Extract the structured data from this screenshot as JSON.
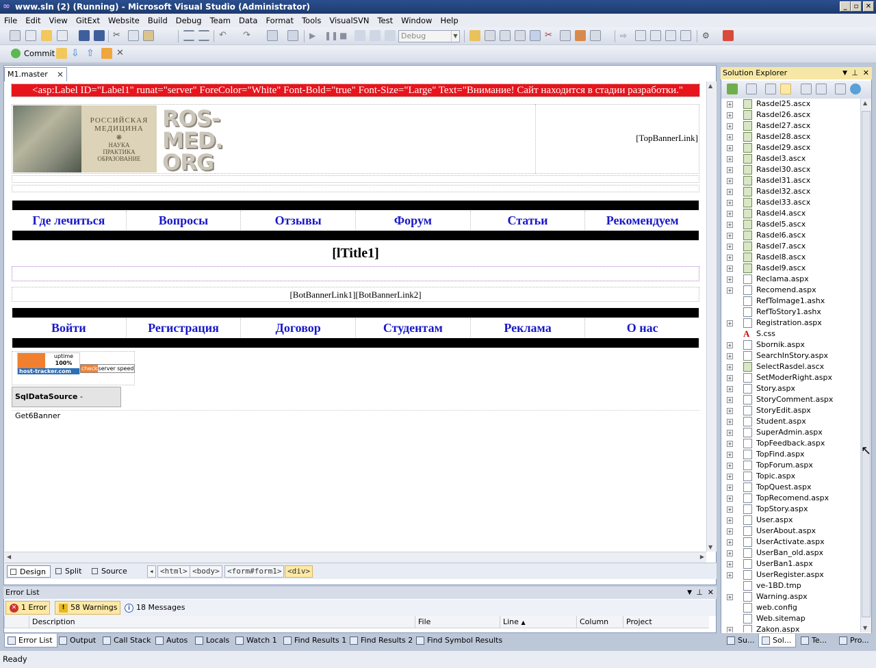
{
  "window": {
    "title": "www.sln (2) (Running) - Microsoft Visual Studio (Administrator)"
  },
  "menu": [
    "File",
    "Edit",
    "View",
    "GitExt",
    "Website",
    "Build",
    "Debug",
    "Team",
    "Data",
    "Format",
    "Tools",
    "VisualSVN",
    "Test",
    "Window",
    "Help"
  ],
  "toolbar": {
    "config": "Debug",
    "commit_label": "Commit"
  },
  "editor": {
    "tab_label": "M1.master",
    "label_markup": "<asp:Label ID=\"Label1\" runat=\"server\" ForeColor=\"White\" Font-Bold=\"true\" Font-Size=\"Large\" Text=\"Внимание! Сайт находится в стадии разработки.\"",
    "banner_text": {
      "ru1": "РОССИЙСКАЯ",
      "ru2": "МЕДИЦИНА",
      "ru3": "НАУКА",
      "ru4": "ПРАКТИКА",
      "ru5": "ОБРАЗОВАНИЕ"
    },
    "logo_lines": [
      "ROS-",
      "MED.",
      "ORG"
    ],
    "top_banner_link": "[TopBannerLink]",
    "nav_top": [
      "Где лечиться",
      "Вопросы",
      "Отзывы",
      "Форум",
      "Статьи",
      "Рекомендуем"
    ],
    "title_placeholder": "[lTitle1]",
    "bot_banner": "[BotBannerLink1][BotBannerLink2]",
    "nav_bottom": [
      "Войти",
      "Регистрация",
      "Договор",
      "Студентам",
      "Реклама",
      "О нас"
    ],
    "tracker": {
      "uptime": "uptime",
      "percent": "100%",
      "brand": "host-tracker.com",
      "check": "check",
      "speed": "server speed"
    },
    "sqldatasource": {
      "type": "SqlDataSource",
      "name": " - Get6Banner"
    }
  },
  "viewbar": {
    "design": "Design",
    "split": "Split",
    "source": "Source",
    "crumbs": [
      "<html>",
      "<body>",
      "<form#form1>",
      "<div>"
    ]
  },
  "solution_explorer": {
    "title": "Solution Explorer",
    "items": [
      {
        "name": "Rasdel25.ascx",
        "type": "ascx",
        "expand": true
      },
      {
        "name": "Rasdel26.ascx",
        "type": "ascx",
        "expand": true
      },
      {
        "name": "Rasdel27.ascx",
        "type": "ascx",
        "expand": true
      },
      {
        "name": "Rasdel28.ascx",
        "type": "ascx",
        "expand": true
      },
      {
        "name": "Rasdel29.ascx",
        "type": "ascx",
        "expand": true
      },
      {
        "name": "Rasdel3.ascx",
        "type": "ascx",
        "expand": true
      },
      {
        "name": "Rasdel30.ascx",
        "type": "ascx",
        "expand": true
      },
      {
        "name": "Rasdel31.ascx",
        "type": "ascx",
        "expand": true
      },
      {
        "name": "Rasdel32.ascx",
        "type": "ascx",
        "expand": true
      },
      {
        "name": "Rasdel33.ascx",
        "type": "ascx",
        "expand": true
      },
      {
        "name": "Rasdel4.ascx",
        "type": "ascx",
        "expand": true
      },
      {
        "name": "Rasdel5.ascx",
        "type": "ascx",
        "expand": true
      },
      {
        "name": "Rasdel6.ascx",
        "type": "ascx",
        "expand": true
      },
      {
        "name": "Rasdel7.ascx",
        "type": "ascx",
        "expand": true
      },
      {
        "name": "Rasdel8.ascx",
        "type": "ascx",
        "expand": true
      },
      {
        "name": "Rasdel9.ascx",
        "type": "ascx",
        "expand": true
      },
      {
        "name": "Reclama.aspx",
        "type": "aspx",
        "expand": true
      },
      {
        "name": "Recomend.aspx",
        "type": "aspx",
        "expand": true
      },
      {
        "name": "RefToImage1.ashx",
        "type": "ashx",
        "expand": false
      },
      {
        "name": "RefToStory1.ashx",
        "type": "ashx",
        "expand": false
      },
      {
        "name": "Registration.aspx",
        "type": "aspx",
        "expand": true
      },
      {
        "name": "S.css",
        "type": "css",
        "expand": false
      },
      {
        "name": "Sbornik.aspx",
        "type": "aspx",
        "expand": true
      },
      {
        "name": "SearchInStory.aspx",
        "type": "aspx",
        "expand": true
      },
      {
        "name": "SelectRasdel.ascx",
        "type": "ascx",
        "expand": true
      },
      {
        "name": "SetModerRight.aspx",
        "type": "aspx",
        "expand": true
      },
      {
        "name": "Story.aspx",
        "type": "aspx",
        "expand": true
      },
      {
        "name": "StoryComment.aspx",
        "type": "aspx",
        "expand": true
      },
      {
        "name": "StoryEdit.aspx",
        "type": "aspx",
        "expand": true
      },
      {
        "name": "Student.aspx",
        "type": "aspx",
        "expand": true
      },
      {
        "name": "SuperAdmin.aspx",
        "type": "aspx",
        "expand": true
      },
      {
        "name": "TopFeedback.aspx",
        "type": "aspx",
        "expand": true
      },
      {
        "name": "TopFind.aspx",
        "type": "aspx",
        "expand": true
      },
      {
        "name": "TopForum.aspx",
        "type": "aspx",
        "expand": true
      },
      {
        "name": "Topic.aspx",
        "type": "aspx",
        "expand": true
      },
      {
        "name": "TopQuest.aspx",
        "type": "aspx",
        "expand": true
      },
      {
        "name": "TopRecomend.aspx",
        "type": "aspx",
        "expand": true
      },
      {
        "name": "TopStory.aspx",
        "type": "aspx",
        "expand": true
      },
      {
        "name": "User.aspx",
        "type": "aspx",
        "expand": true
      },
      {
        "name": "UserAbout.aspx",
        "type": "aspx",
        "expand": true
      },
      {
        "name": "UserActivate.aspx",
        "type": "aspx",
        "expand": true
      },
      {
        "name": "UserBan_old.aspx",
        "type": "aspx",
        "expand": true
      },
      {
        "name": "UserBan1.aspx",
        "type": "aspx",
        "expand": true
      },
      {
        "name": "UserRegister.aspx",
        "type": "aspx",
        "expand": true
      },
      {
        "name": "ve-1BD.tmp",
        "type": "tmp",
        "expand": false
      },
      {
        "name": "Warning.aspx",
        "type": "aspx",
        "expand": true
      },
      {
        "name": "web.config",
        "type": "config",
        "expand": false
      },
      {
        "name": "Web.sitemap",
        "type": "sitemap",
        "expand": false
      },
      {
        "name": "Zakon.aspx",
        "type": "aspx",
        "expand": true
      }
    ]
  },
  "error_list": {
    "title": "Error List",
    "errors": "1 Error",
    "warnings": "58 Warnings",
    "messages": "18 Messages",
    "columns": [
      "Description",
      "File",
      "Line",
      "Column",
      "Project"
    ]
  },
  "bottom_tabs": [
    "Error List",
    "Output",
    "Call Stack",
    "Autos",
    "Locals",
    "Watch 1",
    "Find Results 1",
    "Find Results 2",
    "Find Symbol Results"
  ],
  "right_tabs": [
    "Su...",
    "Sol...",
    "Te...",
    "Pro..."
  ],
  "status": "Ready"
}
